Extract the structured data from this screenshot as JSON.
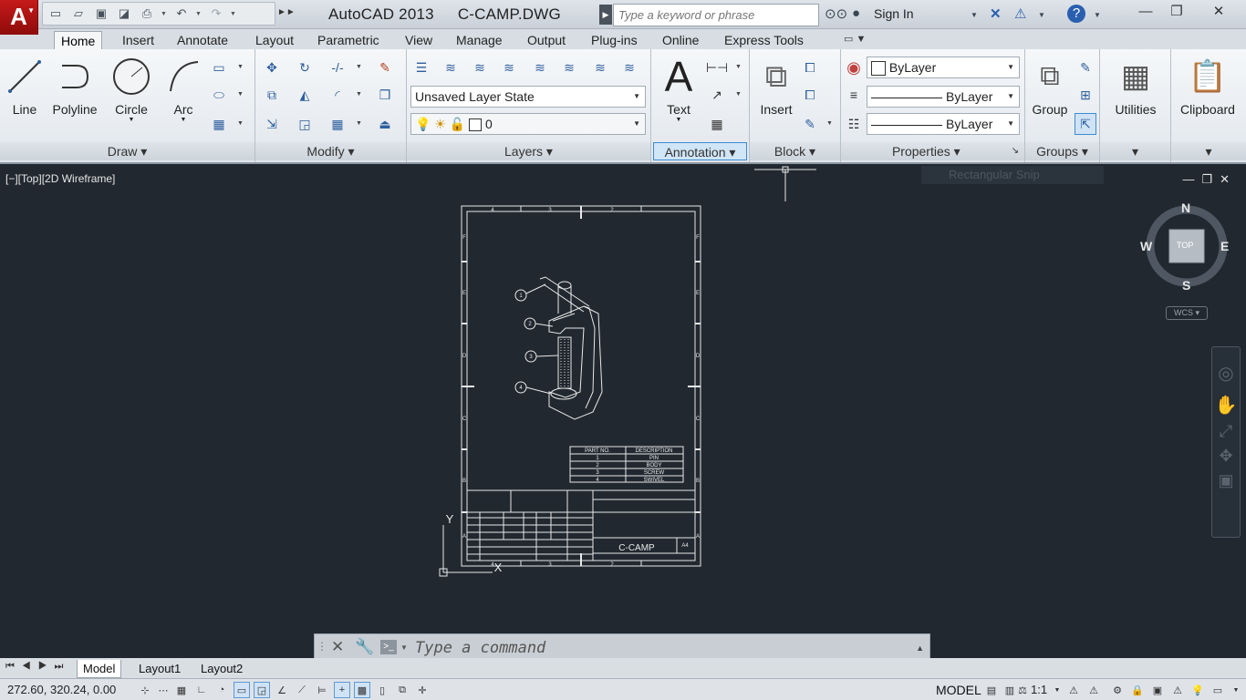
{
  "title": {
    "app": "AutoCAD 2013",
    "file": "C-CAMP.DWG"
  },
  "app_button": {
    "label": "A"
  },
  "search": {
    "placeholder": "Type a keyword or phrase"
  },
  "signin": {
    "label": "Sign In"
  },
  "ribbon_tabs": [
    "Home",
    "Insert",
    "Annotate",
    "Layout",
    "Parametric",
    "View",
    "Manage",
    "Output",
    "Plug-ins",
    "Online",
    "Express Tools"
  ],
  "panels": {
    "draw": {
      "title": "Draw",
      "tools": [
        "Line",
        "Polyline",
        "Circle",
        "Arc"
      ]
    },
    "modify": {
      "title": "Modify"
    },
    "layers": {
      "title": "Layers",
      "layer_state": "Unsaved Layer State",
      "current_layer": "0"
    },
    "annotation": {
      "title": "Annotation",
      "text": "Text"
    },
    "block": {
      "title": "Block",
      "insert": "Insert"
    },
    "properties": {
      "title": "Properties",
      "color": "ByLayer",
      "linetype": "ByLayer",
      "lineweight": "ByLayer"
    },
    "groups": {
      "title": "Groups",
      "group": "Group"
    },
    "utilities": {
      "label": "Utilities"
    },
    "clipboard": {
      "label": "Clipboard"
    }
  },
  "viewport": {
    "label": "[−][Top][2D Wireframe]",
    "ghost_text": "Rectangular Snip"
  },
  "viewcube": {
    "n": "N",
    "s": "S",
    "e": "E",
    "w": "W",
    "face": "TOP",
    "wcs": "WCS"
  },
  "drawing": {
    "title": "C-CAMP",
    "size": "A4",
    "border_cols_top": [
      "4",
      "3",
      "2"
    ],
    "border_cols_bottom": [
      "4",
      "3",
      "2"
    ],
    "border_rows": [
      "F",
      "E",
      "D",
      "C",
      "B",
      "A"
    ],
    "balloons": [
      "1",
      "2",
      "3",
      "4"
    ],
    "parts_header": [
      "PART NO.",
      "DESCRIPTION"
    ],
    "parts": [
      [
        "1",
        "PIN"
      ],
      [
        "2",
        "BODY"
      ],
      [
        "3",
        "SCREW"
      ],
      [
        "4",
        "SWIVEL"
      ]
    ],
    "ucs_y": "Y",
    "ucs_x": "X"
  },
  "command": {
    "placeholder": "Type a command"
  },
  "layout_tabs": [
    "Model",
    "Layout1",
    "Layout2"
  ],
  "status": {
    "coords": "272.60, 320.24, 0.00",
    "space": "MODEL",
    "scale": "1:1"
  }
}
